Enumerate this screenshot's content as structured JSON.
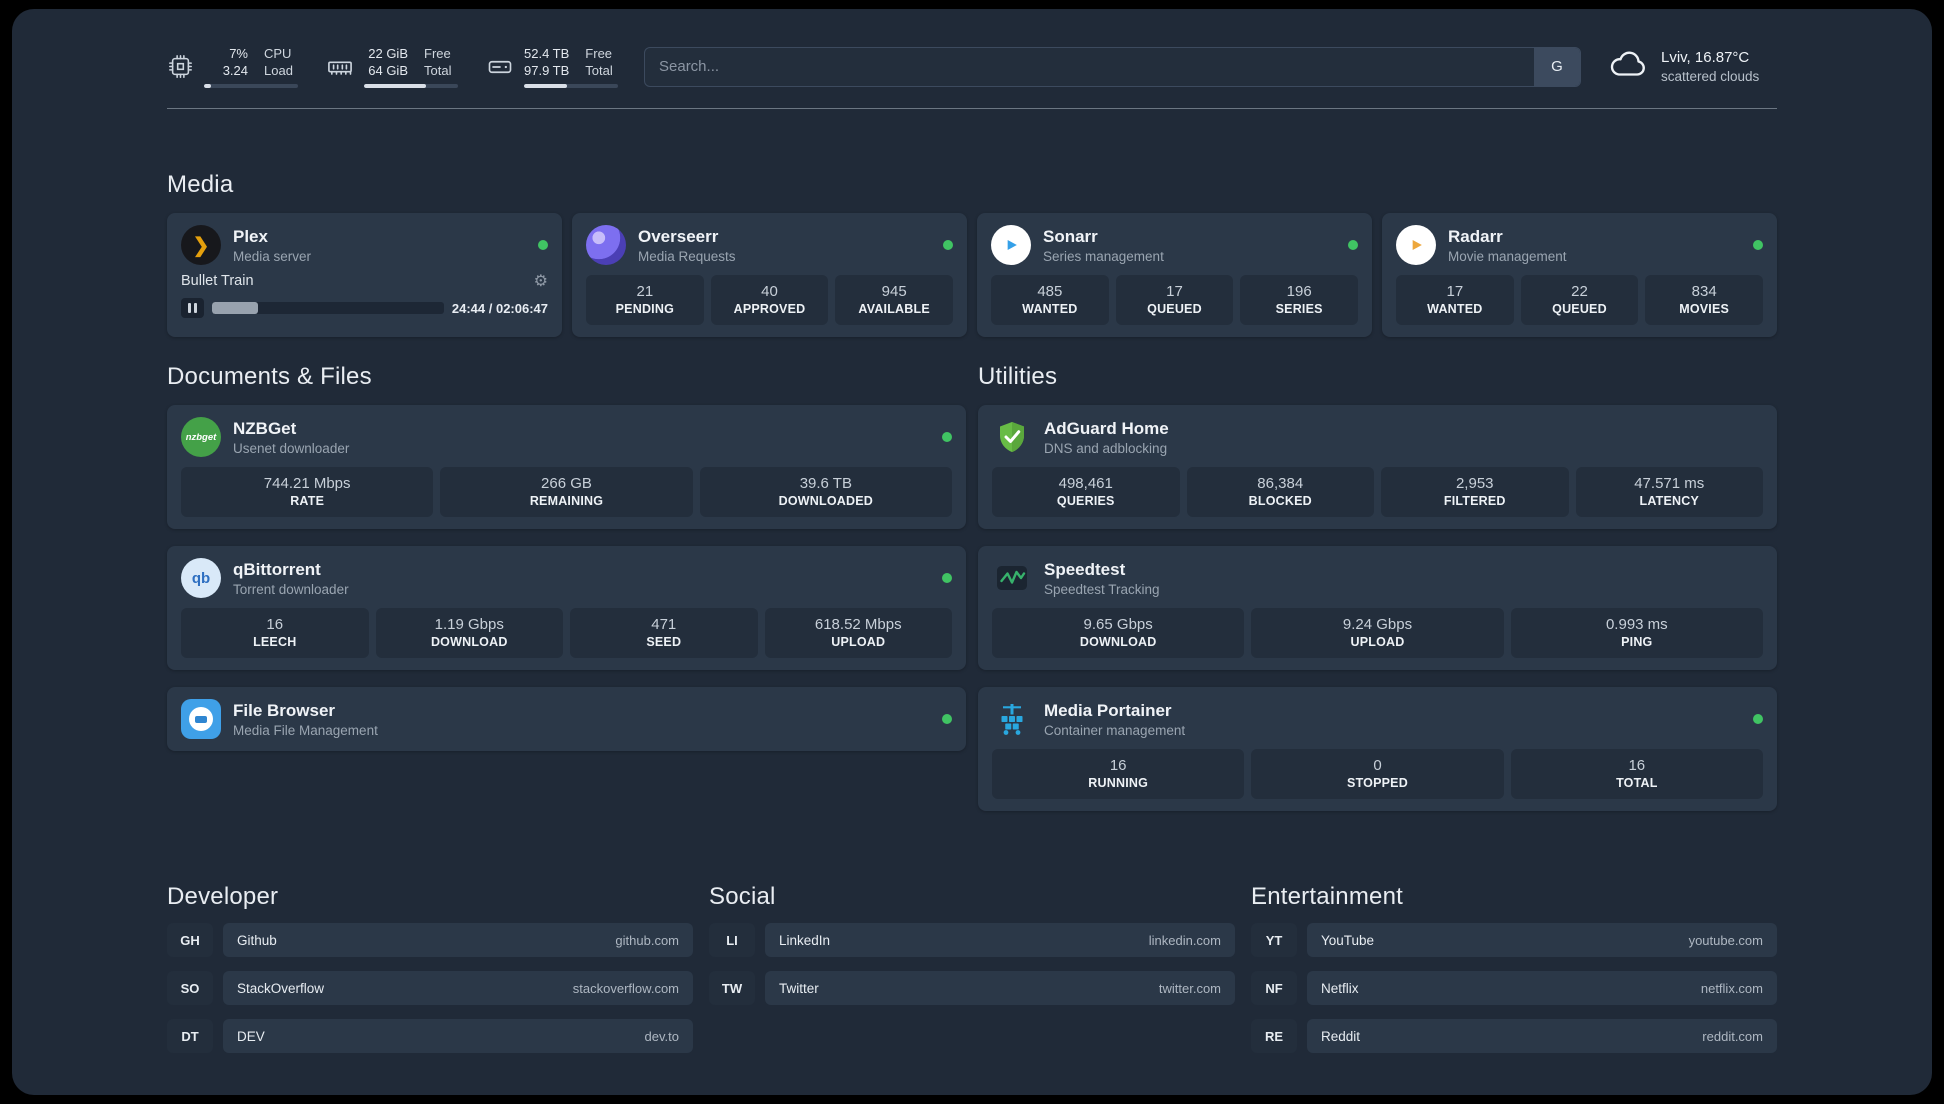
{
  "topbar": {
    "cpu": {
      "value_top": "7%",
      "value_bottom": "3.24",
      "label_top": "CPU",
      "label_bottom": "Load",
      "bar_percent": 7
    },
    "ram": {
      "value_top": "22 GiB",
      "value_bottom": "64 GiB",
      "label_top": "Free",
      "label_bottom": "Total",
      "bar_percent": 66
    },
    "disk": {
      "value_top": "52.4 TB",
      "value_bottom": "97.9 TB",
      "label_top": "Free",
      "label_bottom": "Total",
      "bar_percent": 46
    },
    "search": {
      "placeholder": "Search...",
      "button_label": "G"
    },
    "weather": {
      "location": "Lviv, 16.87°C",
      "condition": "scattered clouds"
    }
  },
  "sections": {
    "media": "Media",
    "documents": "Documents & Files",
    "utilities": "Utilities",
    "developer": "Developer",
    "social": "Social",
    "entertainment": "Entertainment"
  },
  "apps": {
    "plex": {
      "name": "Plex",
      "subtitle": "Media server",
      "now_playing": "Bullet Train",
      "time": "24:44 / 02:06:47",
      "progress_percent": 20,
      "icon_glyph": "❯"
    },
    "overseerr": {
      "name": "Overseerr",
      "subtitle": "Media Requests",
      "stats": [
        {
          "value": "21",
          "label": "PENDING"
        },
        {
          "value": "40",
          "label": "APPROVED"
        },
        {
          "value": "945",
          "label": "AVAILABLE"
        }
      ]
    },
    "sonarr": {
      "name": "Sonarr",
      "subtitle": "Series management",
      "stats": [
        {
          "value": "485",
          "label": "WANTED"
        },
        {
          "value": "17",
          "label": "QUEUED"
        },
        {
          "value": "196",
          "label": "SERIES"
        }
      ]
    },
    "radarr": {
      "name": "Radarr",
      "subtitle": "Movie management",
      "stats": [
        {
          "value": "17",
          "label": "WANTED"
        },
        {
          "value": "22",
          "label": "QUEUED"
        },
        {
          "value": "834",
          "label": "MOVIES"
        }
      ]
    },
    "nzbget": {
      "name": "NZBGet",
      "subtitle": "Usenet downloader",
      "icon_text": "nzbget",
      "stats": [
        {
          "value": "744.21 Mbps",
          "label": "RATE"
        },
        {
          "value": "266 GB",
          "label": "REMAINING"
        },
        {
          "value": "39.6 TB",
          "label": "DOWNLOADED"
        }
      ]
    },
    "qbittorrent": {
      "name": "qBittorrent",
      "subtitle": "Torrent downloader",
      "icon_text": "qb",
      "stats": [
        {
          "value": "16",
          "label": "LEECH"
        },
        {
          "value": "1.19 Gbps",
          "label": "DOWNLOAD"
        },
        {
          "value": "471",
          "label": "SEED"
        },
        {
          "value": "618.52 Mbps",
          "label": "UPLOAD"
        }
      ]
    },
    "filebrowser": {
      "name": "File Browser",
      "subtitle": "Media File Management"
    },
    "adguard": {
      "name": "AdGuard Home",
      "subtitle": "DNS and adblocking",
      "stats": [
        {
          "value": "498,461",
          "label": "QUERIES"
        },
        {
          "value": "86,384",
          "label": "BLOCKED"
        },
        {
          "value": "2,953",
          "label": "FILTERED"
        },
        {
          "value": "47.571 ms",
          "label": "LATENCY"
        }
      ]
    },
    "speedtest": {
      "name": "Speedtest",
      "subtitle": "Speedtest Tracking",
      "stats": [
        {
          "value": "9.65 Gbps",
          "label": "DOWNLOAD"
        },
        {
          "value": "9.24 Gbps",
          "label": "UPLOAD"
        },
        {
          "value": "0.993 ms",
          "label": "PING"
        }
      ]
    },
    "portainer": {
      "name": "Media Portainer",
      "subtitle": "Container management",
      "stats": [
        {
          "value": "16",
          "label": "RUNNING"
        },
        {
          "value": "0",
          "label": "STOPPED"
        },
        {
          "value": "16",
          "label": "TOTAL"
        }
      ]
    }
  },
  "bookmarks": {
    "developer": [
      {
        "abbr": "GH",
        "name": "Github",
        "url": "github.com"
      },
      {
        "abbr": "SO",
        "name": "StackOverflow",
        "url": "stackoverflow.com"
      },
      {
        "abbr": "DT",
        "name": "DEV",
        "url": "dev.to"
      }
    ],
    "social": [
      {
        "abbr": "LI",
        "name": "LinkedIn",
        "url": "linkedin.com"
      },
      {
        "abbr": "TW",
        "name": "Twitter",
        "url": "twitter.com"
      }
    ],
    "entertainment": [
      {
        "abbr": "YT",
        "name": "YouTube",
        "url": "youtube.com"
      },
      {
        "abbr": "NF",
        "name": "Netflix",
        "url": "netflix.com"
      },
      {
        "abbr": "RE",
        "name": "Reddit",
        "url": "reddit.com"
      }
    ]
  }
}
